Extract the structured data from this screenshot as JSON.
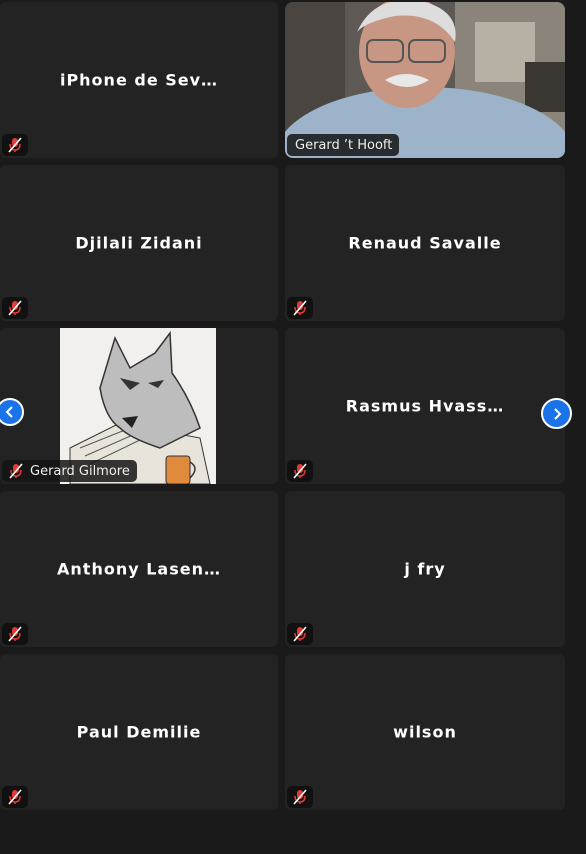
{
  "participants": [
    {
      "name": "iPhone de Sev…",
      "video": false,
      "muted": true
    },
    {
      "name": "Gerard ’t Hooft",
      "video": true,
      "muted": false
    },
    {
      "name": "Djilali Zidani",
      "video": false,
      "muted": true
    },
    {
      "name": "Renaud Savalle",
      "video": false,
      "muted": true
    },
    {
      "name": "Gerard Gilmore",
      "video": true,
      "muted": true
    },
    {
      "name": "Rasmus Hvass…",
      "video": false,
      "muted": true
    },
    {
      "name": "Anthony Lasen…",
      "video": false,
      "muted": true
    },
    {
      "name": "j fry",
      "video": false,
      "muted": true
    },
    {
      "name": "Paul Demilie",
      "video": false,
      "muted": true
    },
    {
      "name": "wilson",
      "video": false,
      "muted": true
    }
  ],
  "icons": {
    "mic": "mic-off-icon",
    "prev": "chevron-left-icon",
    "next": "chevron-right-icon"
  },
  "colors": {
    "tile_bg": "#232323",
    "page_bg": "#1a1a1a",
    "nav_blue": "#1a73e8",
    "muted_red": "#e53935"
  }
}
